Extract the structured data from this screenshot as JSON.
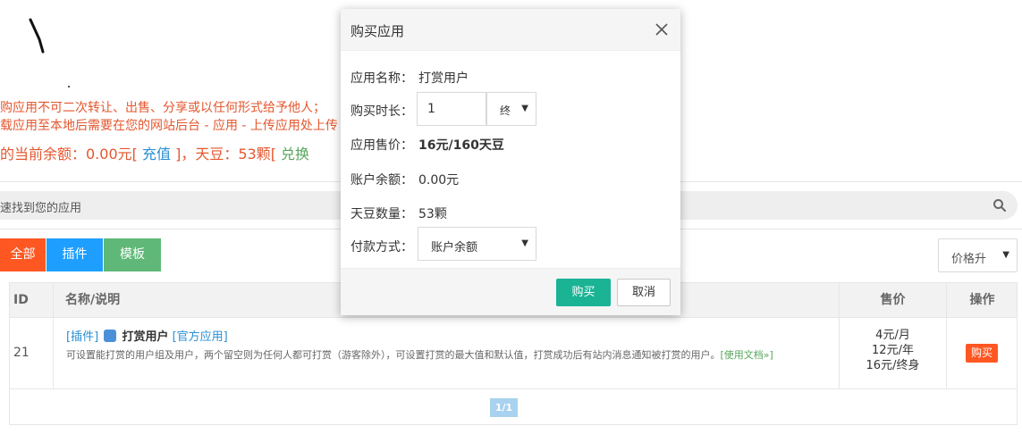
{
  "page": {
    "notice_line1": "购应用不可二次转让、出售、分享或以任何形式给予他人；",
    "notice_line2": "载应用至本地后需要在您的网站后台 - 应用 - 上传应用处上传",
    "balance_prefix": "的当前余额：0.00元",
    "recharge_link": "充值",
    "beans_text": "，天豆：53颗",
    "exchange_link": "兑换",
    "search_placeholder": "速找到您的应用",
    "filters": {
      "all": "全部",
      "plugin": "插件",
      "template": "模板"
    },
    "sort": {
      "selected": "价格升"
    }
  },
  "table": {
    "headers": {
      "id": "ID",
      "name": "名称/说明",
      "price": "售价",
      "op": "操作"
    },
    "rows": [
      {
        "id": "21",
        "type_tag": "[插件]",
        "name": "打赏用户",
        "official_tag": "[官方应用]",
        "description": "可设置能打赏的用户组及用户，两个留空则为任何人都可打赏（游客除外），可设置打赏的最大值和默认值，打赏成功后有站内消息通知被打赏的用户。",
        "doc_link": "[使用文档»]",
        "prices": [
          "4元/月",
          "12元/年",
          "16元/终身"
        ],
        "buy_label": "购买"
      }
    ]
  },
  "pagination": {
    "label": "1/1"
  },
  "modal": {
    "title": "购买应用",
    "app_name_label": "应用名称：",
    "app_name_value": "打赏用户",
    "duration_label": "购买时长：",
    "duration_value": "1",
    "duration_unit": "终",
    "price_label": "应用售价：",
    "price_value": "16元/160天豆",
    "balance_label": "账户余额：",
    "balance_value": "0.00元",
    "beans_label": "天豆数量：",
    "beans_value": "53颗",
    "payment_label": "付款方式：",
    "payment_value": "账户余额",
    "buy_button": "购买",
    "cancel_button": "取消"
  },
  "colors": {
    "accent_orange": "#ff5722",
    "accent_blue": "#1e9fff",
    "accent_green": "#5fb878",
    "buy_teal": "#1ab394"
  }
}
